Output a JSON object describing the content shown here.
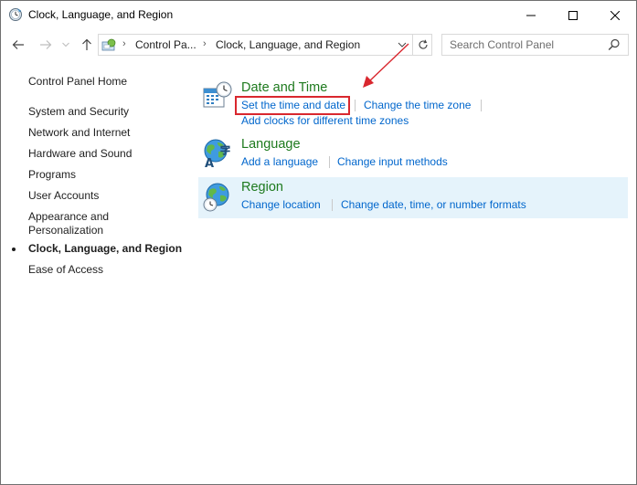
{
  "window": {
    "title": "Clock, Language, and Region",
    "controls": {
      "minimize": "minimize",
      "maximize": "maximize",
      "close": "close"
    }
  },
  "address": {
    "crumbs": [
      "Control Pa...",
      "Clock, Language, and Region"
    ]
  },
  "search": {
    "placeholder": "Search Control Panel",
    "value": ""
  },
  "sidebar": {
    "home": "Control Panel Home",
    "items": [
      "System and Security",
      "Network and Internet",
      "Hardware and Sound",
      "Programs",
      "User Accounts",
      "Appearance and",
      "Personalization",
      "Clock, Language, and Region",
      "Ease of Access"
    ]
  },
  "categories": {
    "date_time": {
      "title": "Date and Time",
      "links": [
        "Set the time and date",
        "Change the time zone",
        "Add clocks for different time zones"
      ]
    },
    "language": {
      "title": "Language",
      "links": [
        "Add a language",
        "Change input methods"
      ]
    },
    "region": {
      "title": "Region",
      "links": [
        "Change location",
        "Change date, time, or number formats"
      ]
    }
  },
  "colors": {
    "category_title": "#1e7a1e",
    "link": "#0066cc",
    "highlight_bg": "#e5f3fb",
    "annotation_red": "#d9272e"
  },
  "icons": {
    "title": "clock-region-icon",
    "date_time": "calendar-clock-icon",
    "language": "globe-language-icon",
    "region": "globe-clock-icon",
    "search": "search-icon",
    "refresh": "refresh-icon"
  }
}
